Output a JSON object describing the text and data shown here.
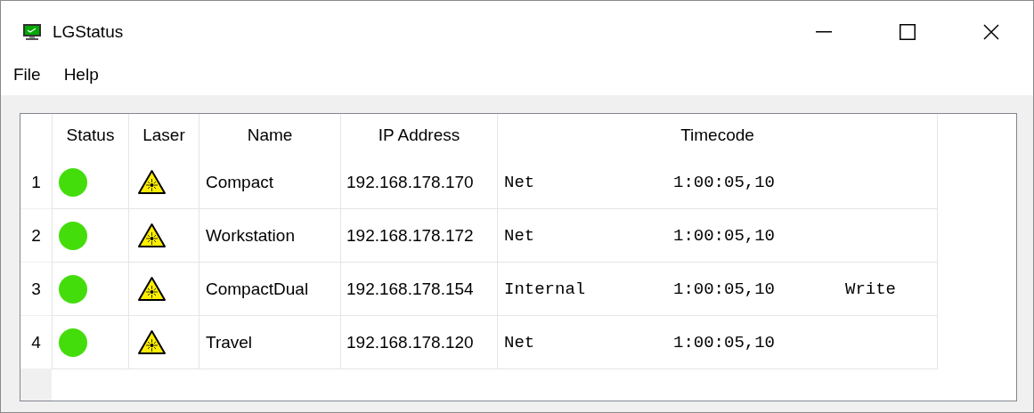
{
  "window": {
    "title": "LGStatus"
  },
  "menu": [
    "File",
    "Help"
  ],
  "table": {
    "columns": [
      "Status",
      "Laser",
      "Name",
      "IP Address",
      "Timecode"
    ],
    "rows": [
      {
        "number": "1",
        "color": "#44dd0c",
        "name": "Compact",
        "ip": "192.168.178.170",
        "source": "Net",
        "timecode": "1:00:05,10"
      },
      {
        "number": "2",
        "color": "#44dd0c",
        "name": "Workstation",
        "ip": "192.168.178.172",
        "source": "Net",
        "timecode": "1:00:05,10"
      },
      {
        "number": "3",
        "color": "#44dd0c",
        "name": "CompactDual",
        "ip": "192.168.178.154",
        "source": "Internal",
        "timecode": "1:00:05,10",
        "mode": "Write"
      },
      {
        "number": "4",
        "color": "#44dd0c",
        "name": "Travel",
        "ip": "192.168.178.120",
        "source": "Net",
        "timecode": "1:00:05,10"
      }
    ]
  }
}
